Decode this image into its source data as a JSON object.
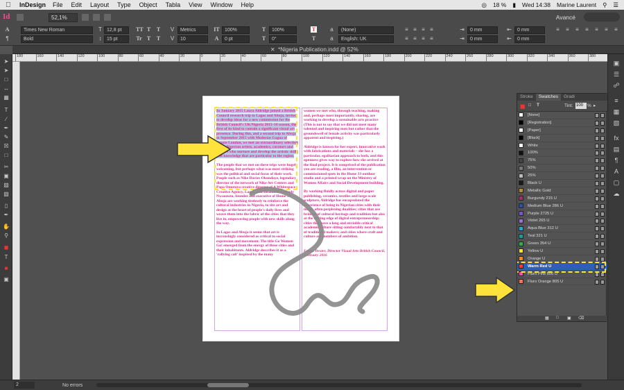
{
  "menubar": {
    "app_name": "InDesign",
    "menus": [
      "File",
      "Edit",
      "Layout",
      "Type",
      "Object",
      "Tabla",
      "View",
      "Window",
      "Help"
    ],
    "status": {
      "battery": "18 %",
      "clock": "Wed 14:38",
      "user": "Marine Laurent"
    }
  },
  "control_panel": {
    "zoom": "52,1%",
    "workspace": "Avancé",
    "font_family": "Times New Roman",
    "font_style": "Bold",
    "font_size": "12,8 pt",
    "leading": "15 pt",
    "kerning": "Metrics",
    "tracking": "10",
    "vertical_scale": "100%",
    "horizontal_scale": "100%",
    "baseline_shift": "0 pt",
    "skew": "0°",
    "char_style": "(None)",
    "language": "English: UK",
    "margin1": "0 mm",
    "margin2": "0 mm",
    "margin3": "0 mm",
    "margin4": "0 mm"
  },
  "document": {
    "tab_title": "*Nigeria Publication.indd @ 52%"
  },
  "ruler": {
    "ticks": [
      "180",
      "160",
      "140",
      "120",
      "100",
      "80",
      "60",
      "40",
      "20",
      "0",
      "20",
      "40",
      "60",
      "80",
      "100",
      "120",
      "140",
      "160",
      "180",
      "200",
      "220",
      "240",
      "260",
      "280",
      "300",
      "320",
      "340",
      "360",
      "380"
    ]
  },
  "page_text": {
    "col1_highlight": "In January 2015 Laura Aldridge joined a British Council research trip to Lagos and Abuja, invited to develop ideas for a new commission for the British Council's UK/Nigeria 2015–16 season, the first of its kind to contain a significant visual art presence. During this, and a second trip to Abuja in September 2015 with Modestas Gagua of Create London, we met an extraordinary selection of the Nigerian artists, academics, curators and makers who nurture and develop the artistic skills and knowledge that are particular to the region.",
    "col1_rest": "The people that we met on these trips were hugely welcoming, but perhaps what was most striking was the political and social focus of their work. People such as Nike Davies Okundaye, legendary director of the network of Nike Art Centres and Papa Omotayo creative director of A Whitespace Creative Agency, Lagos, and Ilisanachi Comedy Nwaozuzu, founder and executive of Home 33, Abuja are working tirelessly to reinforce the cultural industries in Nigeria, to site art and design at the heart of people's daily lives and weave them into the fabric of the cities that they live in, empowering people with new skills along the way.",
    "col1_rest2": "In Lagos and Abuja it seems that art is increasingly considered as critical to social expression and movement. The title Go Women Go! emerged from the energy of these cities and their inhabitants. Aldridge describes it as a 'rallying call' inspired by the many",
    "col2_a": "women we met who, through teaching, making and, perhaps most importantly, sharing, are working to develop a sustainable arts practice (This is not to say that we did not meet many talented and inspiring men but rather that the groundswell of female activity was particularly apparent and inspiring.)",
    "col2_b": "Aldridge is known for her expert, innovative work with fabrications and materials – she has a particular, egalitarian approach to both, and this openness gives way to explore how she arrived at the final project. It is comprised of the publication you are reading, a film, an intervention or commissioned spots in the Home 33 outdoor studio and a printed wrap on the Ministry of Women Affairs and Social Development building.",
    "col2_c": "By working fluidly across digital and paper publishing, ceramics, textiles and large-scale sculpture, Aldridge has encapsulated the experience of being in Nigerian cities with their many, often perplexing dualities; cities that are brimful of cultural heritage and tradition but also at the cutting edge of digital entrepreneurship; cities that have a long and enviable critical academic culture sitting comfortably next to that of traditional makers; and cities where craft and culture are members of ambition.",
    "signature": "Emma Dexter, Director Visual Arts British Council, February 2016"
  },
  "swatches_panel": {
    "tabs": [
      "Stroke",
      "Swatches",
      "Gradi"
    ],
    "tint_label": "Tint:",
    "tint_value": "100",
    "tint_unit": "%",
    "items": [
      {
        "name": "[None]",
        "color": "#ffffff"
      },
      {
        "name": "[Registration]",
        "color": "#000000"
      },
      {
        "name": "[Paper]",
        "color": "#ffffff"
      },
      {
        "name": "[Black]",
        "color": "#000000"
      },
      {
        "name": "White",
        "color": "#ffffff"
      },
      {
        "name": "100%",
        "color": "#111111"
      },
      {
        "name": "75%",
        "color": "#444444"
      },
      {
        "name": "50%",
        "color": "#777777"
      },
      {
        "name": "25%",
        "color": "#bbbbbb"
      },
      {
        "name": "Black U",
        "color": "#1a1a1a"
      },
      {
        "name": "Metallic Gold",
        "color": "#b08d3a"
      },
      {
        "name": "Burgundy 215 U",
        "color": "#a0306a"
      },
      {
        "name": "Medium Blue 286 U",
        "color": "#2c4fa8"
      },
      {
        "name": "Purple 2725 U",
        "color": "#7a56c8"
      },
      {
        "name": "Violet 265 U",
        "color": "#9a70d4"
      },
      {
        "name": "Aqua Blue 312 U",
        "color": "#22a8d4"
      },
      {
        "name": "Teal 321 U",
        "color": "#14a09a"
      },
      {
        "name": "Green 354 U",
        "color": "#2bb04a"
      },
      {
        "name": "Yellow U",
        "color": "#f5e52a"
      },
      {
        "name": "Orange U",
        "color": "#f28a1e"
      },
      {
        "name": "Warm Red U",
        "color": "#e8402a",
        "selected": true
      },
      {
        "name": "Fluro Pink 806 U",
        "color": "#f64aa8"
      },
      {
        "name": "Fluro Orange 805 U",
        "color": "#ff6f50"
      }
    ]
  },
  "statusbar": {
    "page": "2",
    "errors": "No errors"
  },
  "annotation_color": "#ffe23a"
}
